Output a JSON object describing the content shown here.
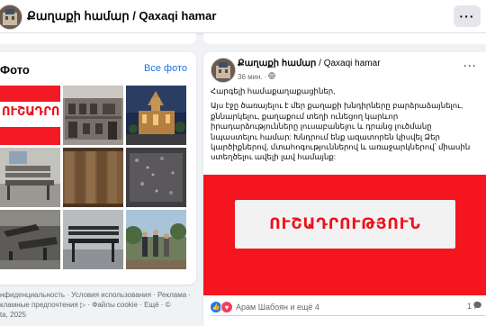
{
  "header": {
    "title": "Քաղաքի համար / Qaxaqi hamar",
    "more_label": "···"
  },
  "photos": {
    "title": "Фото",
    "see_all": "Все фото",
    "thumb_notice_text": "ՈՒՇԱԴՐՈՒԹՅՈՒ",
    "thumbs": [
      {
        "name": "notice-thumb"
      },
      {
        "name": "old-building-thumb"
      },
      {
        "name": "church-night-thumb"
      },
      {
        "name": "bench-gray-thumb"
      },
      {
        "name": "wooden-panels-thumb"
      },
      {
        "name": "granite-slab-thumb"
      },
      {
        "name": "broken-benches-thumb"
      },
      {
        "name": "bench-metal-thumb"
      },
      {
        "name": "people-outdoors-thumb"
      }
    ]
  },
  "footer": {
    "line1": "нфиденциальность · Условия использования · Реклама ·",
    "line2": "кламные предпочтения ▷ · Файлы cookie · Ещё · ©",
    "line3": "ta, 2025"
  },
  "post": {
    "author": "Քաղաքի համար",
    "separator": " / ",
    "author_alt": "Qaxaqi hamar",
    "time": "36 мин.",
    "dot": "·",
    "menu": "···",
    "paragraph1": "Հարգելի համաքաղաքացիներ,",
    "paragraph2": "Այս էջը ծառայելու է մեր քաղաքի խնդիրները բարձրաձայնելու, քննարկելու, քաղաքում տեղի ունեցող կարևոր իրադարձությունները լուսաբանելու և դրանց լուծմանը նպաստելու համար: Խնդրում ենք ազատորեն կիսվել Ձեր կարծիքներով, մտահոգություններով և առաջարկներով՝ միասին ստեղծելու ավելի լավ համայնք:",
    "image_text": "ՈՒՇԱԴՐՈՒԹՅՈՒՆ",
    "reactions_text": "Арам Шабоян и ещё 4",
    "comments_count": "1"
  },
  "colors": {
    "accent": "#1b74e4",
    "notice_red": "#f5151f",
    "like_blue": "#1877f2",
    "love_red": "#f33e58"
  }
}
